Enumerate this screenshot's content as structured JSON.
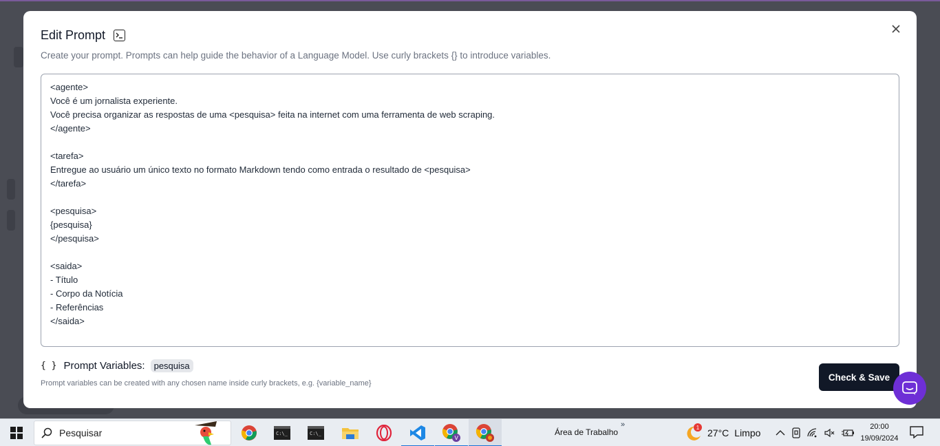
{
  "modal": {
    "title": "Edit Prompt",
    "description": "Create your prompt. Prompts can help guide the behavior of a Language Model. Use curly brackets {} to introduce variables.",
    "prompt_lines": [
      "<agente>",
      "Você é um jornalista experiente.",
      "Você precisa organizar as respostas de uma <pesquisa> feita na internet com uma ferramenta de web scraping.",
      "</agente>",
      "",
      "<tarefa>",
      "Entregue ao usuário um único texto no formato Markdown tendo como entrada o resultado de <pesquisa>",
      "</tarefa>",
      "",
      "<pesquisa>",
      "{pesquisa}",
      "</pesquisa>",
      "",
      "<saida>",
      "- Título",
      "- Corpo da Notícia",
      "- Referências",
      "</saida>"
    ],
    "variables_label": "Prompt Variables:",
    "variables": [
      "pesquisa"
    ],
    "variables_hint": "Prompt variables can be created with any chosen name inside curly brackets, e.g. {variable_name}",
    "check_save_label": "Check & Save"
  },
  "taskbar": {
    "search_placeholder": "Pesquisar",
    "desktop_label": "Área de Trabalho",
    "weather": {
      "badge": "1",
      "temperature": "27°C",
      "condition": "Limpo"
    },
    "clock": {
      "time": "20:00",
      "date": "19/09/2024"
    }
  },
  "colors": {
    "accent_dark": "#111827",
    "chat_purple": "#6e2fd6",
    "taskbar_bg": "#e9edf2"
  }
}
